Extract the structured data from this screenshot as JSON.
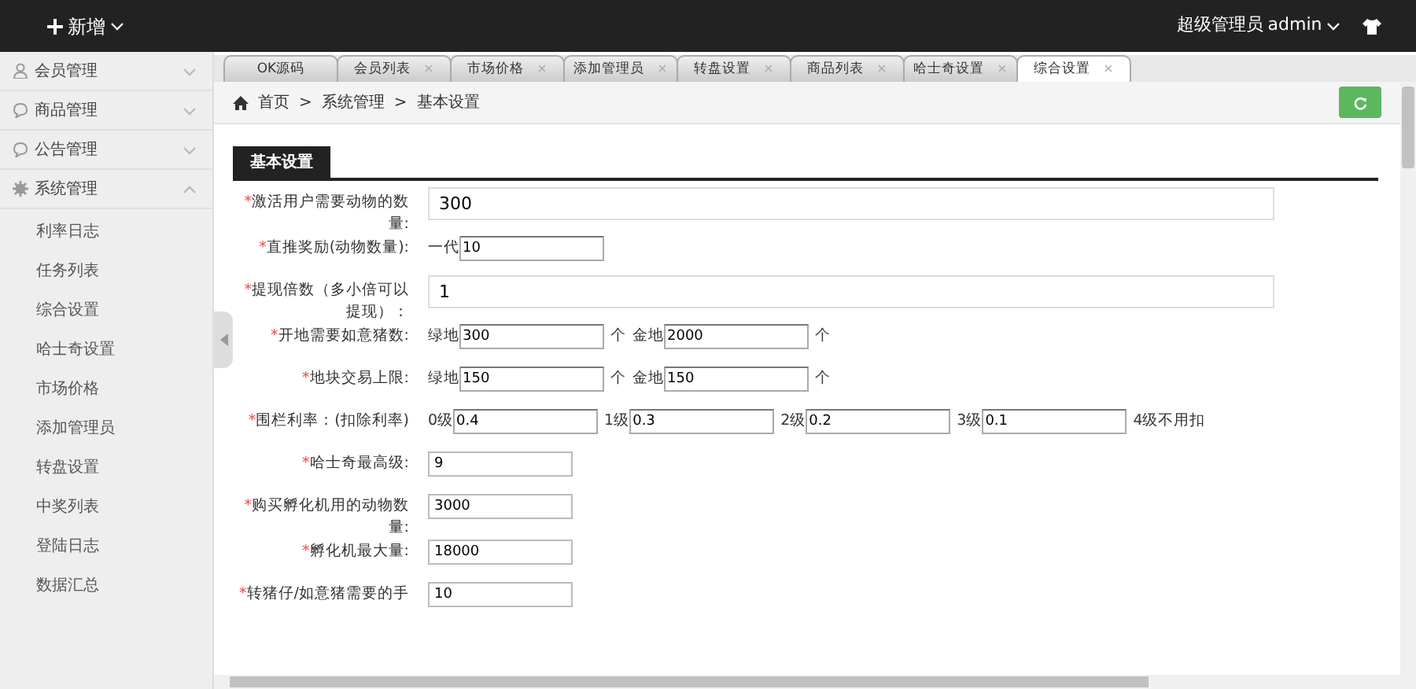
{
  "topbar": {
    "add_label": "新增",
    "role": "超级管理员",
    "user": "admin"
  },
  "sidebar": {
    "groups": [
      {
        "label": "会员管理",
        "expanded": false
      },
      {
        "label": "商品管理",
        "expanded": false
      },
      {
        "label": "公告管理",
        "expanded": false
      },
      {
        "label": "系统管理",
        "expanded": true,
        "children": [
          "利率日志",
          "任务列表",
          "综合设置",
          "哈士奇设置",
          "市场价格",
          "添加管理员",
          "转盘设置",
          "中奖列表",
          "登陆日志",
          "数据汇总"
        ]
      }
    ]
  },
  "tabs": [
    {
      "label": "OK源码",
      "selected": false
    },
    {
      "label": "会员列表",
      "close": "×",
      "selected": false
    },
    {
      "label": "市场价格",
      "close": "×",
      "selected": false
    },
    {
      "label": "添加管理员",
      "close": "×",
      "selected": false
    },
    {
      "label": "转盘设置",
      "close": "×",
      "selected": false
    },
    {
      "label": "商品列表",
      "close": "×",
      "selected": false
    },
    {
      "label": "哈士奇设置",
      "close": "×",
      "selected": false
    },
    {
      "label": "综合设置",
      "close": "×",
      "selected": true
    }
  ],
  "breadcrumb": {
    "separator": ">",
    "items": [
      "首页",
      "系统管理",
      "基本设置"
    ]
  },
  "section_title": "基本设置",
  "form": [
    {
      "mark": "*",
      "label": "激活用户需要动物的数量:",
      "kind": "wide",
      "fields": [
        {
          "value": "300"
        }
      ]
    },
    {
      "mark": "*",
      "label": "直推奖励(动物数量):",
      "kind": "inline",
      "fields": [
        {
          "prefix": "一代",
          "value": "10"
        }
      ]
    },
    {
      "mark": "*",
      "label": "提现倍数（多小倍可以提现）：",
      "kind": "wide",
      "fields": [
        {
          "value": "1"
        }
      ]
    },
    {
      "mark": "*",
      "label": "开地需要如意猪数:",
      "kind": "inline",
      "fields": [
        {
          "prefix": "绿地",
          "value": "300",
          "suffix": "个"
        },
        {
          "prefix": "金地",
          "value": "2000",
          "suffix": "个"
        }
      ]
    },
    {
      "mark": "*",
      "label": "地块交易上限:",
      "kind": "inline",
      "fields": [
        {
          "prefix": "绿地",
          "value": "150",
          "suffix": "个"
        },
        {
          "prefix": "金地",
          "value": "150",
          "suffix": "个"
        }
      ]
    },
    {
      "mark": "*",
      "label": "围栏利率：(扣除利率)",
      "kind": "inline",
      "fields": [
        {
          "prefix": "0级",
          "value": "0.4"
        },
        {
          "prefix": "1级",
          "value": "0.3"
        },
        {
          "prefix": "2级",
          "value": "0.2"
        },
        {
          "prefix": "3级",
          "value": "0.1",
          "suffix": "4级不用扣"
        }
      ]
    },
    {
      "mark": "*",
      "label": "哈士奇最高级:",
      "kind": "small",
      "fields": [
        {
          "value": "9"
        }
      ]
    },
    {
      "mark": "*",
      "label": "购买孵化机用的动物数量:",
      "kind": "small",
      "fields": [
        {
          "value": "3000"
        }
      ]
    },
    {
      "mark": "*",
      "label": "孵化机最大量:",
      "kind": "small",
      "fields": [
        {
          "value": "18000"
        }
      ]
    },
    {
      "mark": "*",
      "label": "转猪仔/如意猪需要的手",
      "kind": "small",
      "fields": [
        {
          "value": "10"
        }
      ]
    }
  ]
}
